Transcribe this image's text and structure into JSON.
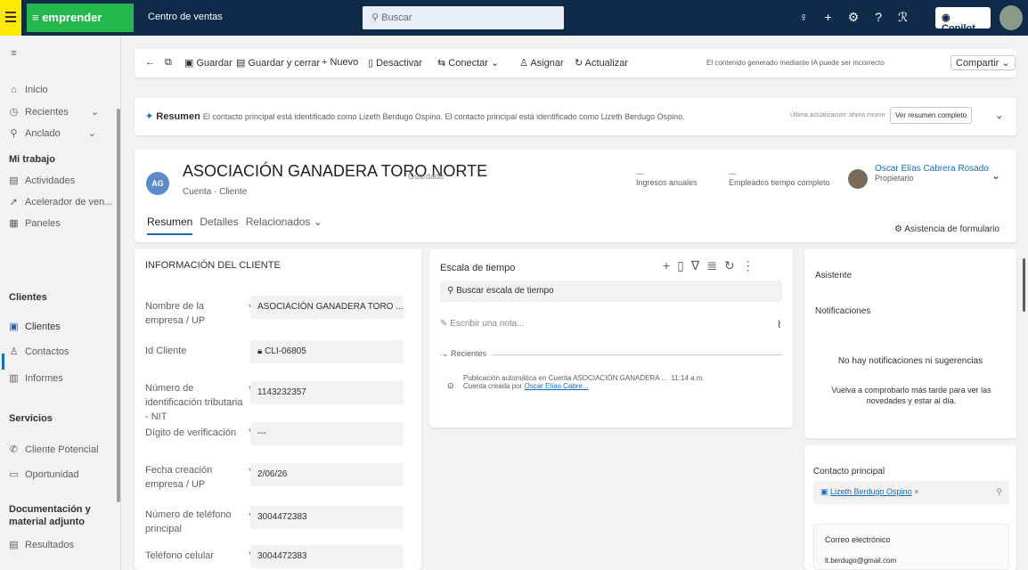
{
  "app": {
    "title": "Centro de ventas",
    "brand": "emprender",
    "search_placeholder": "Buscar",
    "copilot_label": "Copilot"
  },
  "sidebar": {
    "top_items": [
      {
        "label": "Inicio",
        "icon": "home-icon"
      },
      {
        "label": "Recientes",
        "icon": "clock-icon"
      },
      {
        "label": "Anclado",
        "icon": "pin-icon"
      }
    ],
    "section_work": "Mi trabajo",
    "work_items": [
      {
        "label": "Actividades"
      },
      {
        "label": "Acelerador de ven..."
      },
      {
        "label": "Paneles"
      }
    ],
    "section_clients": "Clientes",
    "client_items": [
      {
        "label": "Clientes"
      },
      {
        "label": "Contactos"
      },
      {
        "label": "Informes"
      }
    ],
    "section_services": "Servicios",
    "service_items": [
      {
        "label": "Cliente Potencial"
      },
      {
        "label": "Oportunidad"
      }
    ],
    "section_docs": "Documentación y material adjunto",
    "doc_items": [
      {
        "label": "Resultados"
      }
    ]
  },
  "commands": {
    "save": "Guardar",
    "save_close": "Guardar y cerrar",
    "new": "Nuevo",
    "deactivate": "Desactivar",
    "connect": "Conectar",
    "assign": "Asignar",
    "refresh": "Actualizar",
    "share": "Compartir",
    "notice": "El contenido generado mediante IA puede ser incorrecto"
  },
  "summary": {
    "label": "Resumen",
    "text": "El contacto principal está identificado como Lizeth Berdugo Ospino. El contacto principal está identificado como Lizeth Berdugo Ospino.",
    "updated": "Última actualización: ahora mismo",
    "full_button": "Ver resumen completo"
  },
  "record": {
    "avatar": "AG",
    "name": "ASOCIACIÓN GANADERA TORO NORTE",
    "saved": "Guardado",
    "subtitle": "Cuenta · Cliente",
    "income_value": "---",
    "income_label": "Ingresos anuales",
    "employees_value": "---",
    "employees_label": "Empleados tiempo completo",
    "owner_name": "Oscar Elías Cabrera Rosado",
    "owner_role": "Propietario"
  },
  "tabs": {
    "summary": "Resumen",
    "details": "Detalles",
    "related": "Relacionados"
  },
  "form_assist": "Asistencia de formulario",
  "client_info": {
    "title": "INFORMACIÓN DEL CLIENTE",
    "fields": [
      {
        "label": "Nombre de la empresa / UP",
        "value": "ASOCIACIÓN GANADERA TORO ..."
      },
      {
        "label": "Id Cliente",
        "value": "CLI-06805"
      },
      {
        "label": "Número de identificación tributaria - NIT",
        "value": "1143232357"
      },
      {
        "label": "Dígito de verificación",
        "value": "---"
      },
      {
        "label": "Fecha creación empresa / UP",
        "value": "2/06/26"
      },
      {
        "label": "Número de teléfono principal",
        "value": "3004472383"
      },
      {
        "label": "Teléfono celular",
        "value": "3004472383"
      }
    ]
  },
  "timeline": {
    "title": "Escala de tiempo",
    "search": "Buscar escala de tiempo",
    "note": "Escribir una nota...",
    "recent": "Recientes",
    "entry_title": "Publicación automática en Cuenta ASOCIACIÓN GANADERA ...",
    "entry_time": "11:14 a.m.",
    "entry_sub_prefix": "Cuenta creada por",
    "entry_sub_link": "Oscar Elías Cabre..."
  },
  "assistant": {
    "title": "Asistente",
    "notif_title": "Notificaciones",
    "empty_title": "No hay notificaciones ni sugerencias",
    "empty_sub": "Vuelva a comprobarlo más tarde para ver las novedades y estar al día."
  },
  "contact_card": {
    "label": "Contacto principal",
    "value": "Lizeth Berdugo Ospino",
    "email_label": "Correo electrónico",
    "email_value": "lt.berdugo@gmail.com"
  },
  "colors": {
    "topbar": "#0f2b4a",
    "accent": "#0f6cbd",
    "brand_green": "#24b84c",
    "highlight": "#ffe800"
  }
}
